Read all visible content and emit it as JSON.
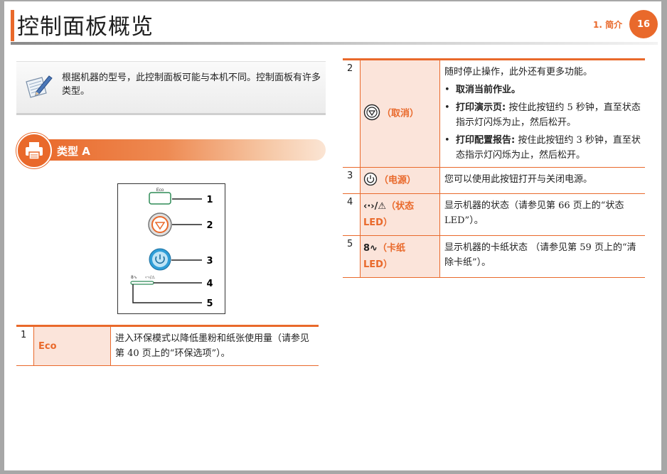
{
  "header": {
    "title": "控制面板概览",
    "chapter": "1.  简介",
    "page_number": "16"
  },
  "note": {
    "text": "根据机器的型号，此控制面板可能与本机不同。控制面板有许多类型。"
  },
  "section": {
    "title": "类型 A"
  },
  "figure": {
    "eco_label": "Eco",
    "callouts": [
      "1",
      "2",
      "3",
      "4",
      "5"
    ]
  },
  "table_left": {
    "rows": [
      {
        "num": "1",
        "name": "Eco",
        "desc": "进入环保模式以降低墨粉和纸张使用量（请参见第 40 页上的“环保选项”）。"
      }
    ]
  },
  "table_right": {
    "row2": {
      "num": "2",
      "name": "（取消）",
      "desc": "随时停止操作，此外还有更多功能。",
      "bullets": [
        {
          "bold": "取消当前作业。",
          "text": ""
        },
        {
          "bold": "打印演示页:",
          "text": " 按住此按钮约 5 秒钟，直至状态指示灯闪烁为止，然后松开。"
        },
        {
          "bold": "打印配置报告:",
          "text": " 按住此按钮约 3 秒钟，直至状态指示灯闪烁为止，然后松开。"
        }
      ]
    },
    "row3": {
      "num": "3",
      "name": "（电源）",
      "desc": "您可以使用此按钮打开与关闭电源。"
    },
    "row4": {
      "num": "4",
      "name_a": "（状态",
      "name_b": "LED）",
      "desc": "显示机器的状态（请参见第 66 页上的“状态 LED”）。"
    },
    "row5": {
      "num": "5",
      "name_a": "（卡纸",
      "name_b": "LED）",
      "desc": "显示机器的卡纸状态 （请参见第 59 页上的“清除卡纸”）。"
    }
  },
  "colors": {
    "accent": "#e9692b",
    "cell_fill": "#fbe4da",
    "power_blue": "#2f9ed8",
    "eco_green": "#2e8b57"
  }
}
